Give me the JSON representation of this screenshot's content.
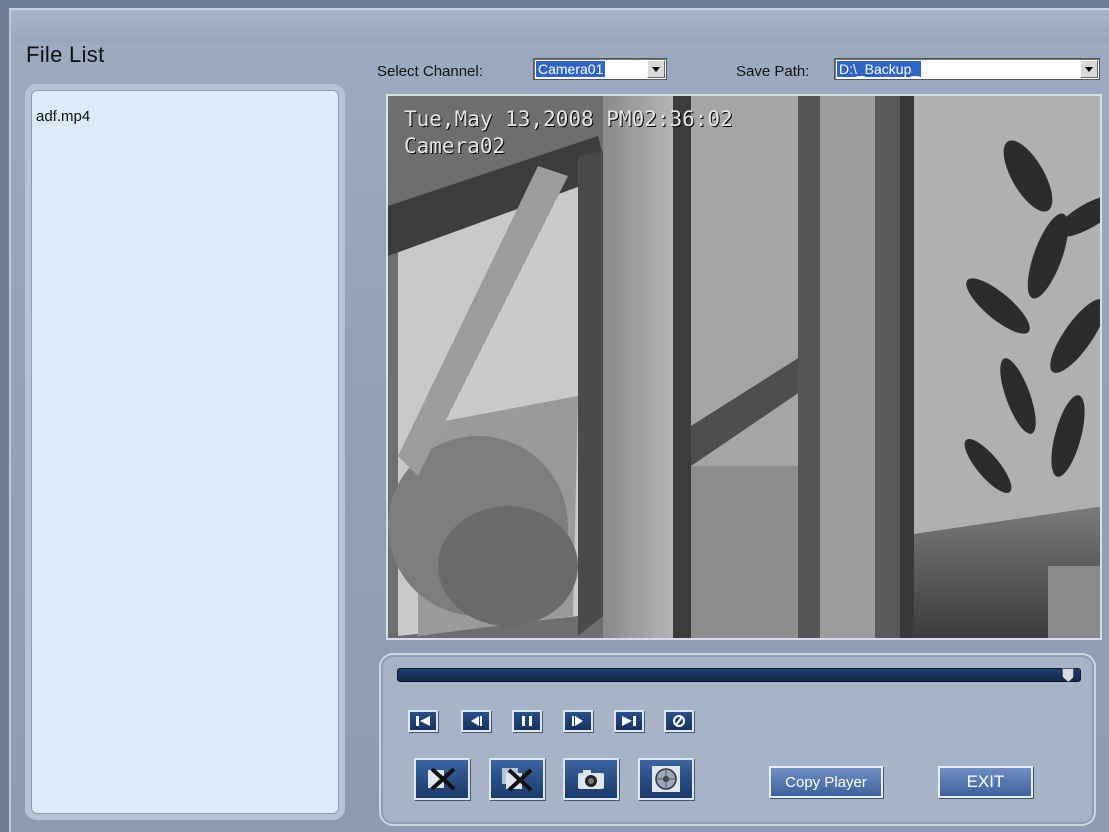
{
  "file_list": {
    "title": "File List",
    "items": [
      "adf.mp4"
    ]
  },
  "channel": {
    "label": "Select Channel:",
    "selected": "Camera01"
  },
  "save_path": {
    "label": "Save Path:",
    "selected": "D:\\_Backup_"
  },
  "video": {
    "osd_datetime": "Tue,May 13,2008 PM02:36:02",
    "osd_camera": "Camera02"
  },
  "playback": {
    "progress_fraction": 0.99,
    "buttons": [
      "skip-to-start-icon",
      "step-back-icon",
      "pause-icon",
      "step-forward-icon",
      "skip-to-end-icon",
      "loop-icon"
    ]
  },
  "actions": {
    "icons": [
      "cut-file-icon",
      "delete-clip-icon",
      "camera-snapshot-icon",
      "disc-burn-icon"
    ],
    "copy_player_label": "Copy Player",
    "exit_label": "EXIT"
  },
  "colors": {
    "background": "#94a2b9",
    "list_bg": "#dcebfb",
    "button_dark": "#1b3a6a",
    "selection": "#2e64c8"
  }
}
